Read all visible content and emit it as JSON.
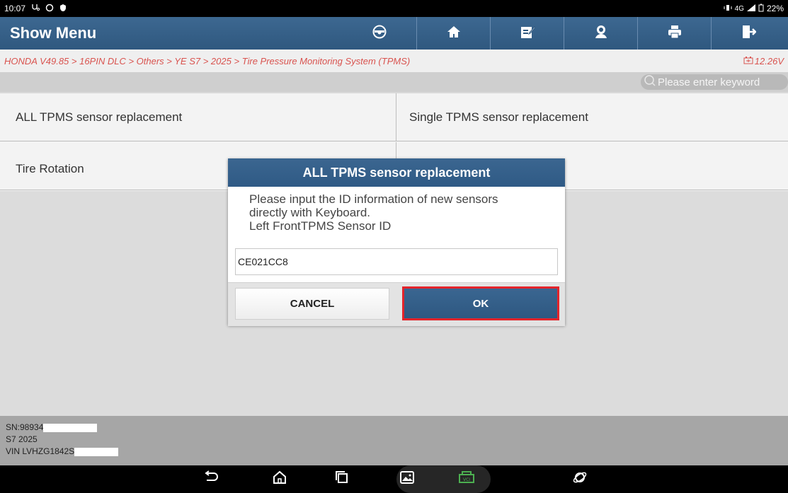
{
  "status_bar": {
    "time": "10:07",
    "network": "4G",
    "battery": "22%"
  },
  "header": {
    "title": "Show Menu",
    "tools": [
      {
        "icon": "steering-wheel-icon"
      },
      {
        "icon": "home-icon"
      },
      {
        "icon": "edit-icon"
      },
      {
        "icon": "user-icon"
      },
      {
        "icon": "print-icon"
      },
      {
        "icon": "exit-icon"
      }
    ]
  },
  "breadcrumb": {
    "path": "HONDA V49.85 > 16PIN DLC > Others > YE S7 > 2025 > Tire Pressure Monitoring System (TPMS)",
    "voltage": "12.26V"
  },
  "search": {
    "placeholder": "Please enter keyword"
  },
  "menu": {
    "items": [
      {
        "label": "ALL TPMS sensor replacement"
      },
      {
        "label": "Single TPMS sensor replacement"
      },
      {
        "label": "Tire Rotation"
      },
      {
        "label": ""
      }
    ]
  },
  "footer": {
    "sn": "SN:98934",
    "model": "S7 2025",
    "vin": "VIN LVHZG1842S"
  },
  "dialog": {
    "title": "ALL TPMS sensor replacement",
    "message": "Please input the ID information of new sensors\ndirectly with Keyboard.\nLeft FrontTPMS Sensor ID",
    "input_value": "CE021CC8",
    "cancel_label": "CANCEL",
    "ok_label": "OK"
  },
  "colors": {
    "header_bg": "#2f587f",
    "breadcrumb_text": "#d9534f",
    "ok_border": "#e3242b"
  }
}
